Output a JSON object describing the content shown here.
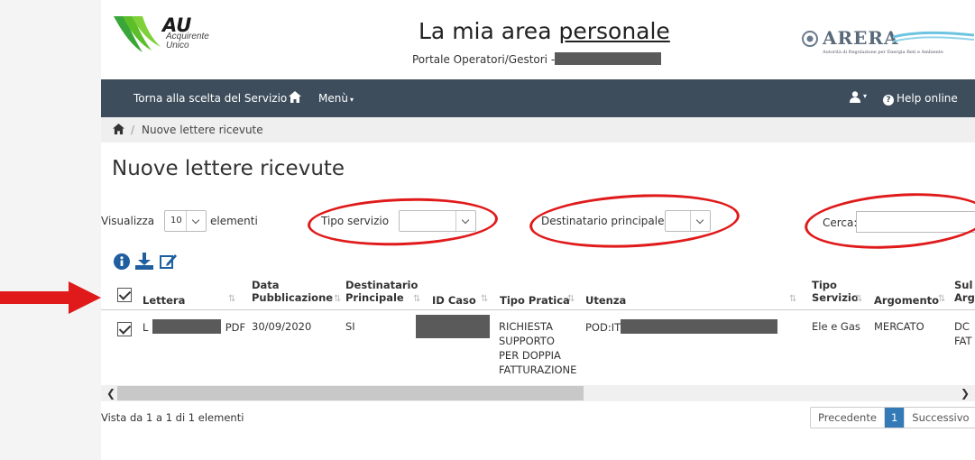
{
  "brand": {
    "au_name": "AU",
    "au_sub1": "Acquirente",
    "au_sub2": "Unico",
    "arera_name": "ARERA",
    "arera_tagline": "Autorità di Regolazione per Energia Reti e Ambiente"
  },
  "header": {
    "title_a": "La mia area ",
    "title_b": "personale",
    "subtitle": "Portale Operatori/Gestori -"
  },
  "navbar": {
    "back": "Torna alla scelta del Servizio",
    "menu": "Menù",
    "help": "Help online"
  },
  "breadcrumb": {
    "current": "Nuove lettere ricevute"
  },
  "page_title": "Nuove lettere ricevute",
  "controls": {
    "show_label": "Visualizza",
    "show_value": "10",
    "show_suffix": "elementi",
    "tipo_servizio_label": "Tipo servizio",
    "destinatario_label": "Destinatario principale",
    "search_label": "Cerca:",
    "search_value": ""
  },
  "table": {
    "headers": {
      "lettera": "Lettera",
      "data_pub_1": "Data",
      "data_pub_2": "Pubblicazione",
      "dest_1": "Destinatario",
      "dest_2": "Principale",
      "id_caso": "ID Caso",
      "tipo_pratica": "Tipo Pratica",
      "utenza": "Utenza",
      "tipo_servizio_1": "Tipo",
      "tipo_servizio_2": "Servizio",
      "argomento": "Argomento",
      "sub_1": "Sul",
      "sub_2": "Arg"
    },
    "row": {
      "lettera_a": "L",
      "lettera_b": "PDF",
      "data": "30/09/2020",
      "destinatario": "SI",
      "pratica_1": "RICHIESTA",
      "pratica_2": "SUPPORTO",
      "pratica_3": "PER DOPPIA",
      "pratica_4": "FATTURAZIONE",
      "utenza": "POD:IT",
      "servizio": "Ele e Gas",
      "argomento": "MERCATO",
      "sub_1": "DC",
      "sub_2": "FAT"
    }
  },
  "footer": {
    "info": "Vista da 1 a 1 di 1 elementi",
    "prev": "Precedente",
    "page": "1",
    "next": "Successivo"
  },
  "colors": {
    "navbar": "#3d4d5c",
    "accent": "#337ab7",
    "annotation": "#e01a1a",
    "au_green": "#3aa63a"
  }
}
